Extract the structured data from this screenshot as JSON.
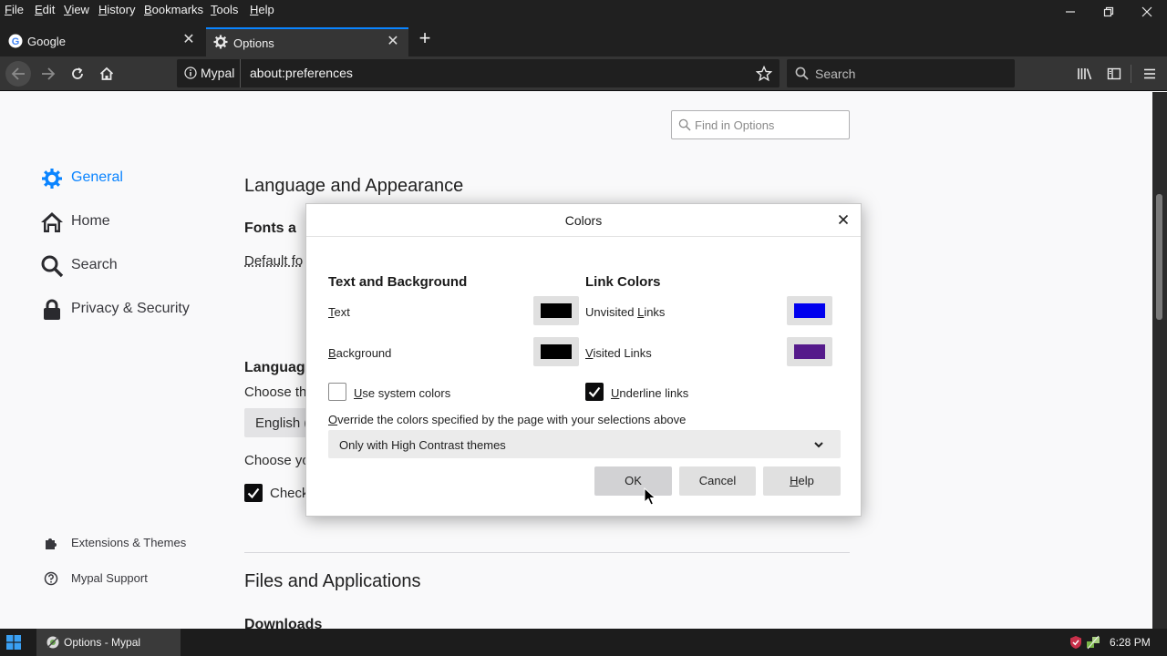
{
  "menubar": {
    "items": [
      {
        "accel": "F",
        "rest": "ile"
      },
      {
        "accel": "E",
        "rest": "dit"
      },
      {
        "accel": "V",
        "rest": "iew"
      },
      {
        "accel": "H",
        "rest": "istory"
      },
      {
        "accel": "B",
        "rest": "ookmarks"
      },
      {
        "accel": "T",
        "rest": "ools"
      },
      {
        "accel": "H",
        "rest": "elp"
      }
    ]
  },
  "tabs": [
    {
      "label": "Google",
      "icon": "google-icon",
      "active": false
    },
    {
      "label": "Options",
      "icon": "gear-icon",
      "active": true
    }
  ],
  "navbar": {
    "identity_label": "Mypal",
    "url": "about:preferences",
    "search_placeholder": "Search"
  },
  "page": {
    "find_placeholder": "Find in Options",
    "sidebar": [
      {
        "label": "General",
        "icon": "gear-icon",
        "selected": true
      },
      {
        "label": "Home",
        "icon": "home-icon",
        "selected": false
      },
      {
        "label": "Search",
        "icon": "search-icon",
        "selected": false
      },
      {
        "label": "Privacy & Security",
        "icon": "lock-icon",
        "selected": false
      }
    ],
    "sidebar_bottom": [
      {
        "label": "Extensions & Themes",
        "icon": "puzzle-icon"
      },
      {
        "label": "Mypal Support",
        "icon": "help-icon"
      }
    ],
    "heading_language_appearance": "Language and Appearance",
    "heading_fonts": "Fonts a",
    "default_font_label": "Default fo",
    "heading_language": "Languag",
    "choose_language_text": "Choose th",
    "language_select_value": "English (",
    "choose_text_2": "Choose yo",
    "check_label": "Check",
    "heading_files": "Files and Applications",
    "heading_downloads": "Downloads"
  },
  "dialog": {
    "title": "Colors",
    "text_bg_heading": "Text and Background",
    "link_colors_heading": "Link Colors",
    "text_label_accel": "T",
    "text_label_rest": "ext",
    "background_label_accel": "B",
    "background_label_rest": "ackground",
    "unvisited_label_pre": "Unvisited ",
    "unvisited_label_accel": "L",
    "unvisited_label_post": "inks",
    "visited_label_accel": "V",
    "visited_label_rest": "isited Links",
    "use_system_colors_accel": "U",
    "use_system_colors_rest": "se system colors",
    "use_system_colors_checked": false,
    "underline_links_accel": "U",
    "underline_links_rest": "nderline links",
    "underline_links_checked": true,
    "override_label_accel": "O",
    "override_label_rest": "verride the colors specified by the page with your selections above",
    "override_value": "Only with High Contrast themes",
    "ok_label": "OK",
    "cancel_label": "Cancel",
    "help_label_accel": "H",
    "help_label_rest": "elp",
    "colors": {
      "text": "#000000",
      "background": "#000000",
      "unvisited": "#0000ee",
      "visited": "#551a8b"
    }
  },
  "taskbar": {
    "app_label": "Options - Mypal",
    "time": "6:28 PM"
  },
  "theme": {
    "accent": "#0a84ff",
    "selected_sidebar": "#0a84ff"
  }
}
